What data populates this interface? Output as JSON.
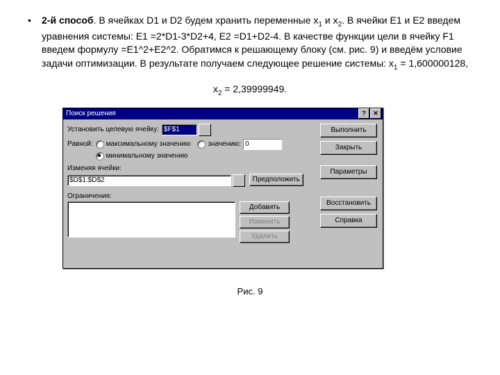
{
  "bullet": "•",
  "para_bold": "2-й способ",
  "para_text_1": ". В ячейках D1 и D2 будем хранить переменные x",
  "para_sub1": "1",
  "para_text_2": " и x",
  "para_sub2": "2",
  "para_text_3": ". В ячейки E1 и E2 введем уравнения системы: E1 =2*D1-3*D2+4, E2 =D1+D2-4. В качестве функции цели в ячейку F1 введем формулу =E1^2+E2^2. Обратимся к решающему блоку (см. рис. 9) и введём условие задачи оптимизации. В результате получаем следующее решение системы: x",
  "para_sub3": "1",
  "para_text_4": " = 1,600000128,",
  "x2_label": "x",
  "x2_sub": "2",
  "x2_val": " = 2,39999949.",
  "dialog": {
    "title": "Поиск решения",
    "help_btn": "?",
    "close_btn": "✕",
    "target_label": "Установить целевую ячейку:",
    "target_value": "$F$1",
    "equal_label": "Равной:",
    "radio_max": "максимальному значению",
    "radio_val": "значению:",
    "val_value": "0",
    "radio_min": "минимальному значению",
    "changing_label": "Изменяя ячейки:",
    "changing_value": "$D$1:$D$2",
    "guess_btn": "Предположить",
    "constraints_label": "Ограничения:",
    "add_btn": "Добавить",
    "change_btn": "Изменить",
    "delete_btn": "Удалить",
    "solve_btn": "Выполнить",
    "close_dlg_btn": "Закрыть",
    "params_btn": "Параметры",
    "restore_btn": "Восстановить",
    "help_dlg_btn": "Справка"
  },
  "caption": "Рис. 9"
}
